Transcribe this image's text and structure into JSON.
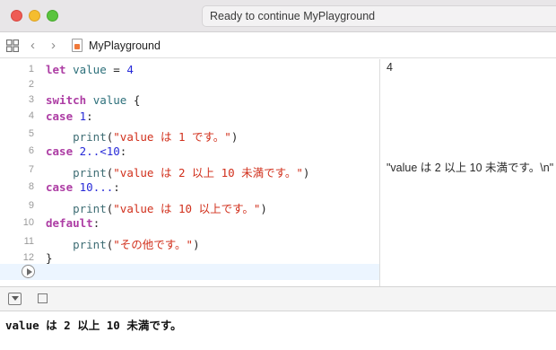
{
  "window": {
    "status": "Ready to continue MyPlayground"
  },
  "jumpbar": {
    "filename": "MyPlayground",
    "icons": [
      "grid-icon",
      "chevron-left-icon",
      "chevron-right-icon",
      "swift-file-icon"
    ]
  },
  "editor": {
    "lines": [
      {
        "n": "1"
      },
      {
        "n": "2"
      },
      {
        "n": "3"
      },
      {
        "n": "4"
      },
      {
        "n": "5"
      },
      {
        "n": "6"
      },
      {
        "n": "7"
      },
      {
        "n": "8"
      },
      {
        "n": "9"
      },
      {
        "n": "10"
      },
      {
        "n": "11"
      },
      {
        "n": "12"
      }
    ],
    "code": {
      "l1_kw": "let",
      "l1_id": "value",
      "l1_eq": " = ",
      "l1_num": "4",
      "l3_kw": "switch",
      "l3_id": "value",
      "l3_brace": " {",
      "l4_kw": "case",
      "l4_num": "1",
      "l4_colon": ":",
      "l5_fn": "print",
      "l5_str": "\"value は 1 です。\"",
      "l6_kw": "case",
      "l6_num": "2..<10",
      "l6_colon": ":",
      "l7_fn": "print",
      "l7_str": "\"value は 2 以上 10 未満です。\"",
      "l8_kw": "case",
      "l8_num": "10...",
      "l8_colon": ":",
      "l9_fn": "print",
      "l9_str": "\"value は 10 以上です。\"",
      "l10_kw": "default",
      "l10_colon": ":",
      "l11_fn": "print",
      "l11_str": "\"その他です。\"",
      "l12_brace": "}"
    }
  },
  "results": {
    "r1": "4",
    "r7": "\"value は 2 以上 10 未満です。\\n\""
  },
  "console": {
    "output": "value は 2 以上 10 未満です。"
  }
}
